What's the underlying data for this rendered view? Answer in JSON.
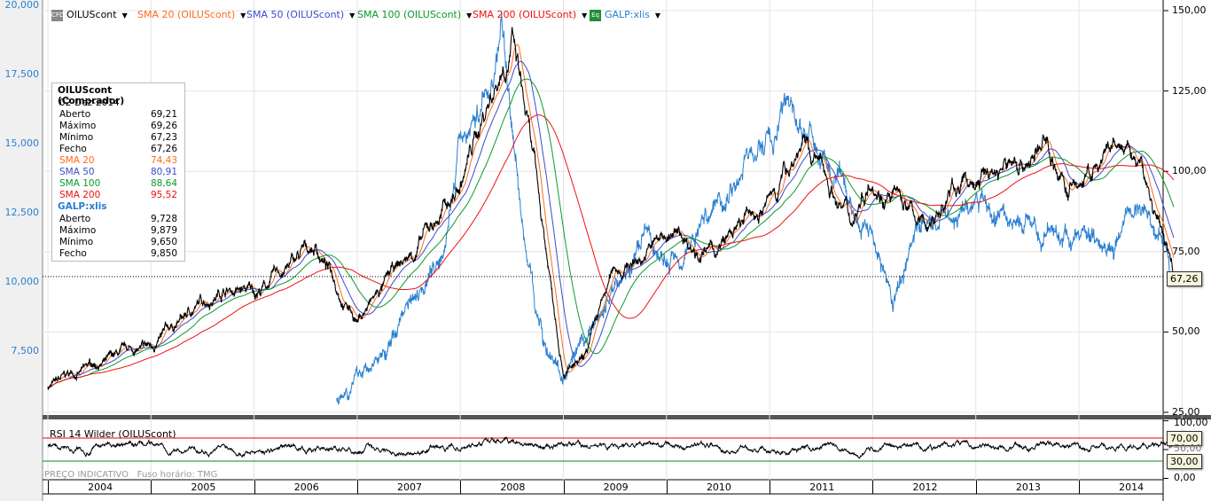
{
  "legend": [
    {
      "label": "OILUScont",
      "color": "#000000",
      "icon": "cfd-icon",
      "icon_text": "CFD"
    },
    {
      "label": "SMA 20 (OILUScont)",
      "color": "#ff6a1a"
    },
    {
      "label": "SMA 50 (OILUScont)",
      "color": "#3b4bc8"
    },
    {
      "label": "SMA 100 (OILUScont)",
      "color": "#0a9a2a"
    },
    {
      "label": "SMA 200 (OILUScont)",
      "color": "#ee1111"
    },
    {
      "label": "GALP:xlis",
      "color": "#2a7fd0",
      "icon": "equity-icon",
      "icon_text": "Eq"
    }
  ],
  "info": {
    "title": "OILUScont (Comprador)",
    "date": "02-Dez-2014",
    "rows": [
      [
        "Aberto",
        "69,21"
      ],
      [
        "Máximo",
        "69,26"
      ],
      [
        "Mínimo",
        "67,23"
      ],
      [
        "Fecho",
        "67,26"
      ]
    ],
    "sma": [
      [
        "SMA 20",
        "74,43",
        "#ff6a1a"
      ],
      [
        "SMA 50",
        "80,91",
        "#3b4bc8"
      ],
      [
        "SMA 100",
        "88,64",
        "#0a9a2a"
      ],
      [
        "SMA 200",
        "95,52",
        "#ee1111"
      ]
    ],
    "galp_title": "GALP:xlis",
    "galp_rows": [
      [
        "Aberto",
        "9,728"
      ],
      [
        "Máximo",
        "9,879"
      ],
      [
        "Mínimo",
        "9,650"
      ],
      [
        "Fecho",
        "9,850"
      ]
    ]
  },
  "current_price": "67,26",
  "rsi": {
    "label": "RSI 14 Wilder (OILUScont)",
    "upper": "70,00",
    "lower": "30,00",
    "ticks": [
      "100,00",
      "50,00",
      "0,00"
    ]
  },
  "footer": {
    "indicative": "PREÇO INDICATIVO",
    "timezone": "Fuso horário: TMG"
  },
  "chart_data": {
    "type": "line",
    "left_axis": {
      "ticks": [
        "7,500",
        "10,000",
        "12,500",
        "15,000",
        "17,500",
        "20,000"
      ],
      "values": [
        7500,
        10000,
        12500,
        15000,
        17500,
        20000
      ]
    },
    "right_axis": {
      "ticks": [
        "25,00",
        "50,00",
        "75,00",
        "100,00",
        "125,00",
        "150,00"
      ],
      "values": [
        25,
        50,
        75,
        100,
        125,
        150
      ]
    },
    "x_labels": [
      "2004",
      "2005",
      "2006",
      "2007",
      "2008",
      "2009",
      "2010",
      "2011",
      "2012",
      "2013",
      "2014"
    ],
    "series": [
      {
        "name": "OILUScont",
        "axis": "right",
        "points": [
          [
            2004.0,
            33
          ],
          [
            2004.5,
            40
          ],
          [
            2005.0,
            44
          ],
          [
            2005.7,
            65
          ],
          [
            2006.0,
            62
          ],
          [
            2006.6,
            76
          ],
          [
            2007.0,
            55
          ],
          [
            2007.5,
            72
          ],
          [
            2008.0,
            95
          ],
          [
            2008.5,
            145
          ],
          [
            2008.9,
            60
          ],
          [
            2009.0,
            40
          ],
          [
            2009.2,
            40
          ],
          [
            2009.5,
            68
          ],
          [
            2010.0,
            80
          ],
          [
            2010.5,
            75
          ],
          [
            2011.0,
            90
          ],
          [
            2011.3,
            110
          ],
          [
            2011.8,
            85
          ],
          [
            2012.0,
            103
          ],
          [
            2012.5,
            82
          ],
          [
            2012.8,
            95
          ],
          [
            2013.0,
            97
          ],
          [
            2013.7,
            108
          ],
          [
            2013.9,
            93
          ],
          [
            2014.4,
            105
          ],
          [
            2014.6,
            100
          ],
          [
            2014.92,
            67.26
          ]
        ]
      },
      {
        "name": "GALP:xlis",
        "axis": "left",
        "points": [
          [
            2006.8,
            5900
          ],
          [
            2007.0,
            6600
          ],
          [
            2007.3,
            7500
          ],
          [
            2007.5,
            9500
          ],
          [
            2007.8,
            11000
          ],
          [
            2008.0,
            15000
          ],
          [
            2008.3,
            17000
          ],
          [
            2008.4,
            19500
          ],
          [
            2008.5,
            16000
          ],
          [
            2008.6,
            12000
          ],
          [
            2008.8,
            8000
          ],
          [
            2009.0,
            6500
          ],
          [
            2009.2,
            7500
          ],
          [
            2009.5,
            10000
          ],
          [
            2009.8,
            11500
          ],
          [
            2010.0,
            10500
          ],
          [
            2010.4,
            12500
          ],
          [
            2010.8,
            14500
          ],
          [
            2011.0,
            15000
          ],
          [
            2011.2,
            16300
          ],
          [
            2011.5,
            14500
          ],
          [
            2011.8,
            12500
          ],
          [
            2012.0,
            12000
          ],
          [
            2012.2,
            9000
          ],
          [
            2012.4,
            12000
          ],
          [
            2012.7,
            12500
          ],
          [
            2013.0,
            12700
          ],
          [
            2013.5,
            12000
          ],
          [
            2014.0,
            11500
          ],
          [
            2014.4,
            11800
          ],
          [
            2014.6,
            12800
          ],
          [
            2014.85,
            11500
          ],
          [
            2014.92,
            9850
          ]
        ]
      }
    ],
    "sma_periods": [
      20,
      50,
      100,
      200
    ],
    "rsi_levels": [
      30,
      70
    ]
  }
}
